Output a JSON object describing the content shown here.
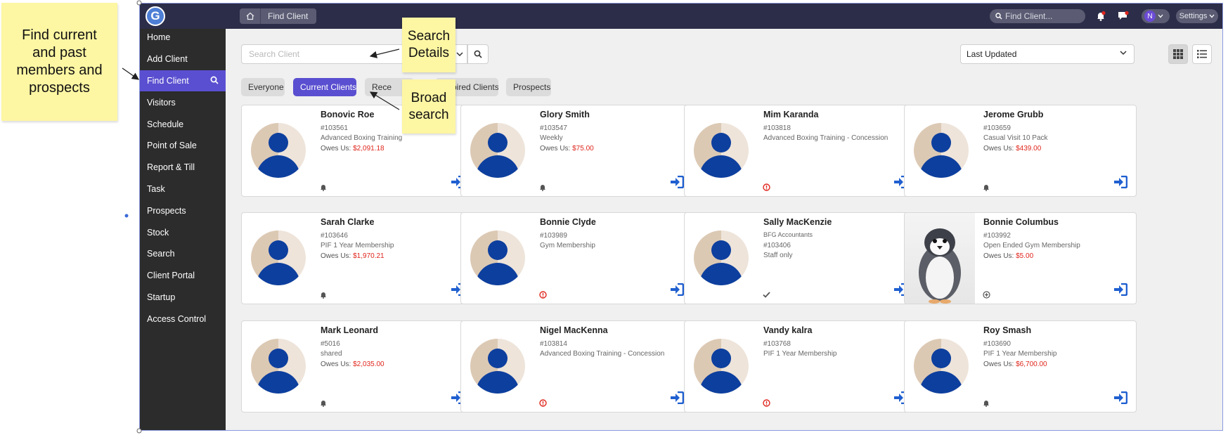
{
  "annotations": {
    "sticky_left": "Find current and past members and prospects",
    "sticky_search": "Search Details",
    "sticky_broad": "Broad search"
  },
  "header": {
    "logo": "G",
    "breadcrumb": "Find Client",
    "search_placeholder": "Find Client...",
    "avatar_initial": "N",
    "settings": "Settings"
  },
  "sidebar": {
    "items": [
      {
        "label": "Home"
      },
      {
        "label": "Add Client"
      },
      {
        "label": "Find Client"
      },
      {
        "label": "Visitors"
      },
      {
        "label": "Schedule"
      },
      {
        "label": "Point of Sale"
      },
      {
        "label": "Report & Till"
      },
      {
        "label": "Task"
      },
      {
        "label": "Prospects"
      },
      {
        "label": "Stock"
      },
      {
        "label": "Search"
      },
      {
        "label": "Client Portal"
      },
      {
        "label": "Startup"
      },
      {
        "label": "Access Control"
      }
    ]
  },
  "toolbar": {
    "search_placeholder": "Search Client",
    "sort_value": "Last Updated"
  },
  "tabs": [
    {
      "label": "Everyone"
    },
    {
      "label": "Current Clients"
    },
    {
      "label": "Rece"
    },
    {
      "label": "Expired Clients"
    },
    {
      "label": "Prospects"
    }
  ],
  "clients": [
    {
      "name": "Bonovic Roe",
      "id": "#103561",
      "plan": "Advanced Boxing Training",
      "owes_label": "Owes Us:",
      "owes": "$2,091.18",
      "status": "bell"
    },
    {
      "name": "Glory Smith",
      "id": "#103547",
      "plan": "Weekly",
      "owes_label": "Owes Us:",
      "owes": "$75.00",
      "status": "bell"
    },
    {
      "name": "Mim Karanda",
      "id": "#103818",
      "plan": "Advanced Boxing Training - Concession",
      "status": "alert"
    },
    {
      "name": "Jerome Grubb",
      "id": "#103659",
      "plan": "Casual Visit 10 Pack",
      "owes_label": "Owes Us:",
      "owes": "$439.00",
      "status": "bell"
    },
    {
      "name": "Sarah Clarke",
      "id": "#103646",
      "plan": "PIF 1 Year Membership",
      "owes_label": "Owes Us:",
      "owes": "$1,970.21",
      "status": "bell"
    },
    {
      "name": "Bonnie Clyde",
      "id": "#103989",
      "plan": "Gym Membership",
      "status": "alert"
    },
    {
      "name": "Sally MacKenzie",
      "company": "BFG Accountants",
      "id": "#103406",
      "plan": "Staff only",
      "status": "check"
    },
    {
      "name": "Bonnie Columbus",
      "id": "#103992",
      "plan": "Open Ended Gym Membership",
      "owes_label": "Owes Us:",
      "owes": "$5.00",
      "status": "plus",
      "photo": true
    },
    {
      "name": "Mark Leonard",
      "id": "#5016",
      "plan": "shared",
      "owes_label": "Owes Us:",
      "owes": "$2,035.00",
      "status": "bell"
    },
    {
      "name": "Nigel MacKenna",
      "id": "#103814",
      "plan": "Advanced Boxing Training - Concession",
      "status": "alert"
    },
    {
      "name": "Vandy kalra",
      "id": "#103768",
      "plan": "PIF 1 Year Membership",
      "status": "alert"
    },
    {
      "name": "Roy Smash",
      "id": "#103690",
      "plan": "PIF 1 Year Membership",
      "owes_label": "Owes Us:",
      "owes": "$6,700.00",
      "status": "bell"
    }
  ],
  "colors": {
    "accent": "#5a4fd0",
    "owes": "#e0261d",
    "alert": "#e0261d",
    "go": "#1f5fd0"
  }
}
